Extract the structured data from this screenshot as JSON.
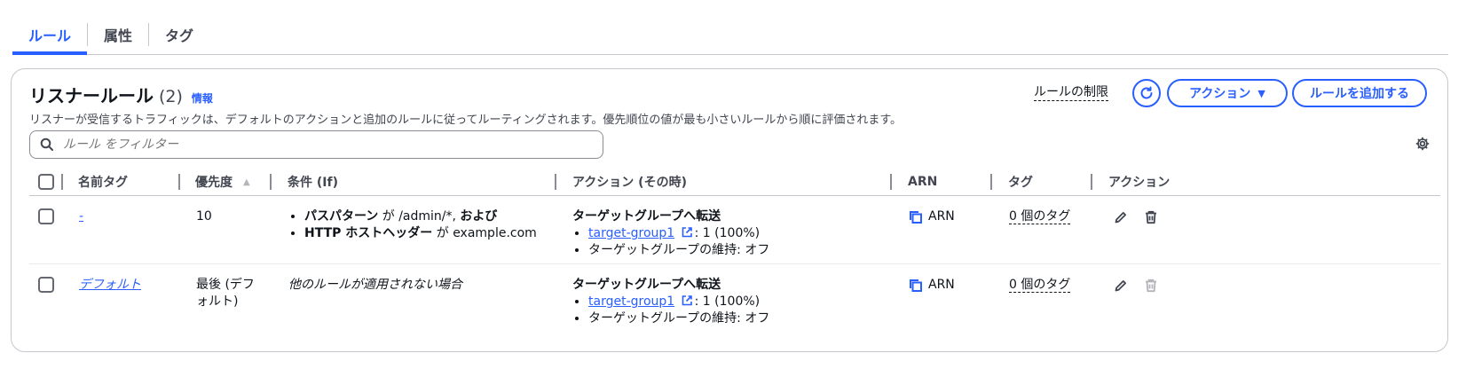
{
  "tabs": [
    "ルール",
    "属性",
    "タグ"
  ],
  "header": {
    "title": "リスナールール",
    "count": "(2)",
    "info": "情報",
    "description": "リスナーが受信するトラフィックは、デフォルトのアクションと追加のルールに従ってルーティングされます。優先順位の値が最も小さいルールから順に評価されます。",
    "limit_link": "ルールの制限",
    "actions_button": "アクション",
    "add_button": "ルールを追加する"
  },
  "search": {
    "placeholder": "ルール をフィルター"
  },
  "columns": {
    "name_tag": "名前タグ",
    "priority": "優先度",
    "condition": "条件 (If)",
    "action": "アクション (その時)",
    "arn": "ARN",
    "tags": "タグ",
    "actions": "アクション"
  },
  "rows": [
    {
      "name": "-",
      "priority": "10",
      "conditions": [
        {
          "key": "パスパターン",
          "mid": "が",
          "value": "/admin/*,",
          "suffix": "および"
        },
        {
          "key": "HTTP ホストヘッダー",
          "mid": "が",
          "value": "example.com",
          "suffix": ""
        }
      ],
      "action_title": "ターゲットグループへ転送",
      "target_group": "target-group1",
      "weight": ": 1 (100%)",
      "stickiness": "ターゲットグループの維持: オフ",
      "arn": "ARN",
      "tags": "0 個のタグ"
    },
    {
      "name": "デフォルト",
      "priority_line1": "最後 (デフ",
      "priority_line2": "ォルト)",
      "condition_text": "他のルールが適用されない場合",
      "action_title": "ターゲットグループへ転送",
      "target_group": "target-group1",
      "weight": ": 1 (100%)",
      "stickiness": "ターゲットグループの維持: オフ",
      "arn": "ARN",
      "tags": "0 個のタグ"
    }
  ],
  "colors": {
    "accent": "#295eff",
    "text": "#0f141a",
    "muted": "#424650",
    "border": "#c6c6cd"
  }
}
